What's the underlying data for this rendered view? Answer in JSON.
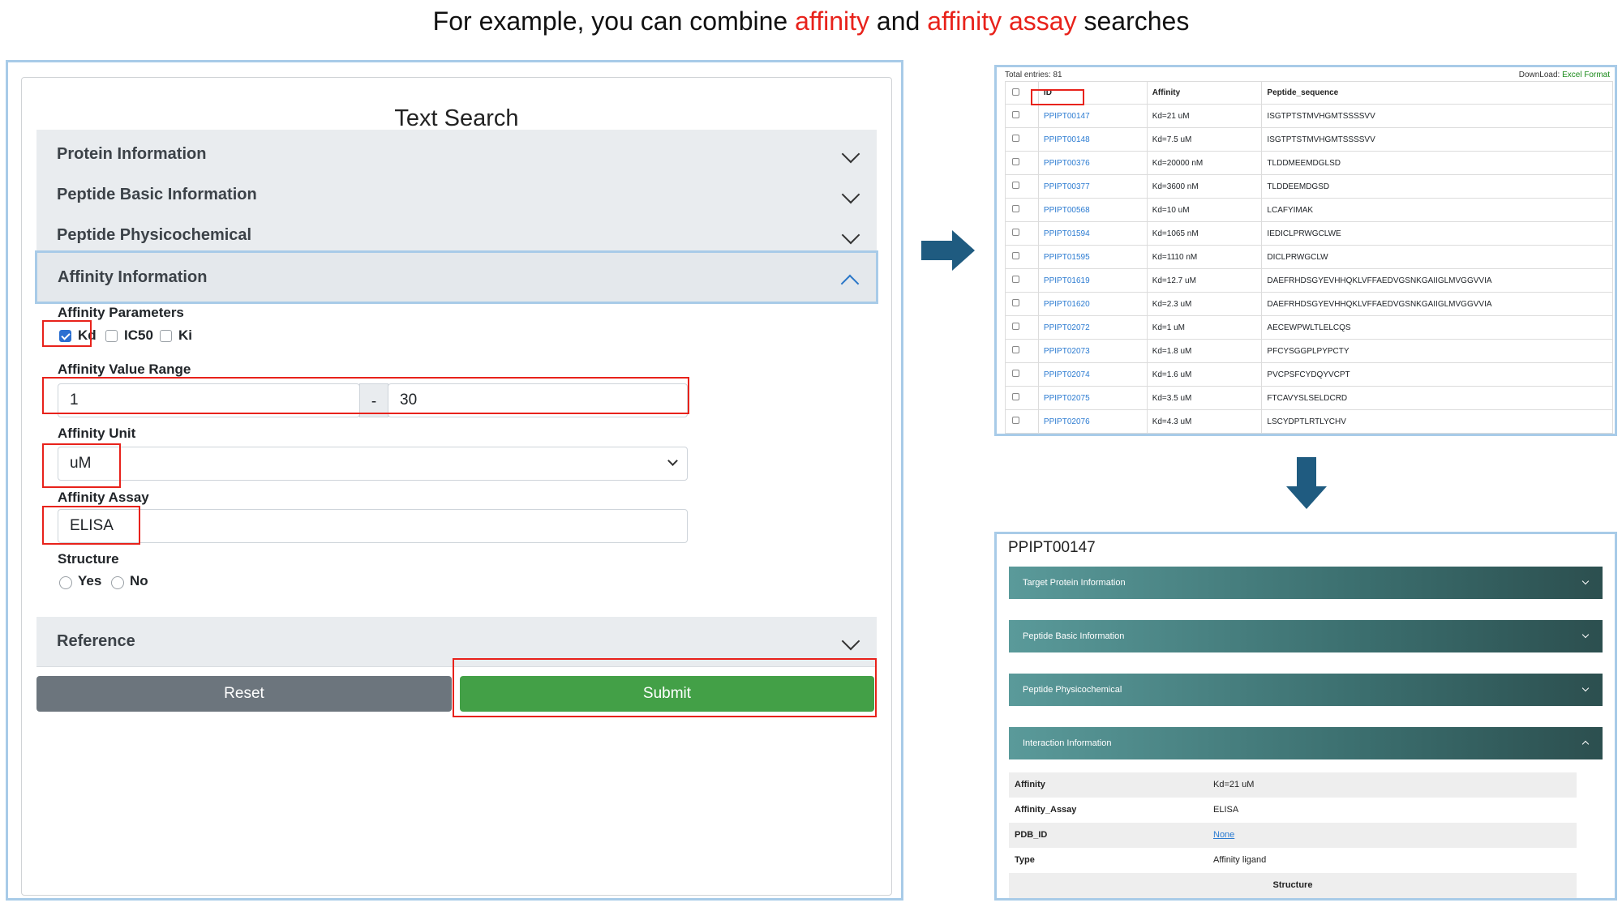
{
  "headline": {
    "part1": "For example, you can combine ",
    "hl1": "affinity",
    "part2": " and ",
    "hl2": "affinity assay",
    "part3": " searches"
  },
  "colors": {
    "highlight": "#e8221b",
    "submit": "#43a047",
    "reset": "#6c757d",
    "accent_border": "#a8cbe8",
    "link": "#2b7bd1",
    "arrow": "#1f5b80"
  },
  "search": {
    "title": "Text Search",
    "sections": [
      "Protein Information",
      "Peptide Basic Information",
      "Peptide Physicochemical",
      "Affinity Information",
      "Reference"
    ],
    "affinity_parameters": {
      "label": "Affinity Parameters",
      "options": [
        {
          "label": "Kd",
          "checked": true
        },
        {
          "label": "IC50",
          "checked": false
        },
        {
          "label": "Ki",
          "checked": false
        }
      ]
    },
    "value_range": {
      "label": "Affinity Value Range",
      "min": "1",
      "separator": "-",
      "max": "30"
    },
    "unit": {
      "label": "Affinity Unit",
      "value": "uM"
    },
    "assay": {
      "label": "Affinity Assay",
      "value": "ELISA"
    },
    "structure": {
      "label": "Structure",
      "options": [
        "Yes",
        "No"
      ]
    },
    "buttons": {
      "reset": "Reset",
      "submit": "Submit"
    }
  },
  "results": {
    "total": "Total entries: 81",
    "download_label": "DownLoad: ",
    "download_link": "Excel Format",
    "columns": [
      "ID",
      "Affinity",
      "Peptide_sequence"
    ],
    "rows": [
      [
        "PPIPT00147",
        "Kd=21 uM",
        "ISGTPTSTMVHGMTSSSSVV"
      ],
      [
        "PPIPT00148",
        "Kd=7.5 uM",
        "ISGTPTSTMVHGMTSSSSVV"
      ],
      [
        "PPIPT00376",
        "Kd=20000 nM",
        "TLDDMEEMDGLSD"
      ],
      [
        "PPIPT00377",
        "Kd=3600 nM",
        "TLDDEEMDGSD"
      ],
      [
        "PPIPT00568",
        "Kd=10 uM",
        "LCAFYIMAK"
      ],
      [
        "PPIPT01594",
        "Kd=1065 nM",
        "IEDICLPRWGCLWE"
      ],
      [
        "PPIPT01595",
        "Kd=1110 nM",
        "DICLPRWGCLW"
      ],
      [
        "PPIPT01619",
        "Kd=12.7 uM",
        "DAEFRHDSGYEVHHQKLVFFAEDVGSNKGAIIGLMVGGVVIA"
      ],
      [
        "PPIPT01620",
        "Kd=2.3 uM",
        "DAEFRHDSGYEVHHQKLVFFAEDVGSNKGAIIGLMVGGVVIA"
      ],
      [
        "PPIPT02072",
        "Kd=1 uM",
        "AECEWPWLTLELCQS"
      ],
      [
        "PPIPT02073",
        "Kd=1.8 uM",
        "PFCYSGGPLPYPCTY"
      ],
      [
        "PPIPT02074",
        "Kd=1.6 uM",
        "PVCPSFCYDQYVCPT"
      ],
      [
        "PPIPT02075",
        "Kd=3.5 uM",
        "FTCAVYSLSELDCRD"
      ],
      [
        "PPIPT02076",
        "Kd=4.3 uM",
        "LSCYDPTLRTLYCHV"
      ]
    ]
  },
  "detail": {
    "title": "PPIPT00147",
    "sections": [
      "Target Protein Information",
      "Peptide Basic Information",
      "Peptide Physicochemical",
      "Interaction Information"
    ],
    "fields": [
      {
        "key": "Affinity",
        "value": "Kd=21 uM"
      },
      {
        "key": "Affinity_Assay",
        "value": "ELISA"
      },
      {
        "key": "PDB_ID",
        "value": "None"
      },
      {
        "key": "Type",
        "value": "Affinity ligand"
      }
    ],
    "structure_label": "Structure"
  }
}
